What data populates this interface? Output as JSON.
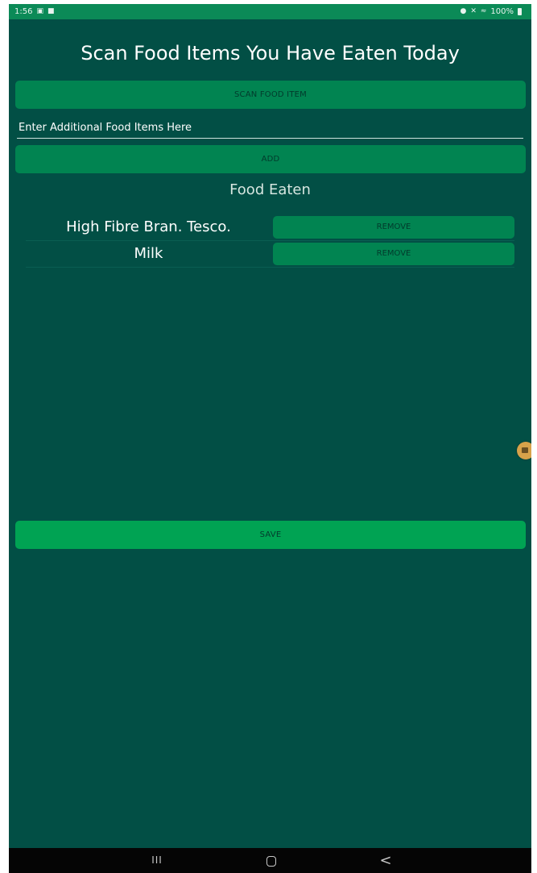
{
  "status_bar": {
    "time": "1:56",
    "left_icons": [
      "image-icon",
      "video-icon"
    ],
    "right_icons": [
      "lock-icon",
      "mute-icon",
      "wifi-icon"
    ],
    "battery": "100%"
  },
  "screen": {
    "title": "Scan Food Items You Have Eaten Today",
    "scan_button_label": "SCAN FOOD ITEM",
    "food_input": {
      "placeholder": "Enter Additional Food Items Here",
      "value": ""
    },
    "add_button_label": "ADD",
    "food_eaten_heading": "Food Eaten",
    "food_items": [
      {
        "name": "High Fibre Bran. Tesco.",
        "remove_label": "REMOVE"
      },
      {
        "name": "Milk",
        "remove_label": "REMOVE"
      }
    ],
    "save_button_label": "SAVE"
  },
  "nav_bar": {
    "recents_glyph": "III",
    "back_glyph": "<"
  },
  "colors": {
    "background": "#024f45",
    "status_bar": "#0b8a57",
    "button": "#018451",
    "save_button": "#00a353",
    "button_text": "#023a2c",
    "floating_recorder": "#d7a24a"
  }
}
